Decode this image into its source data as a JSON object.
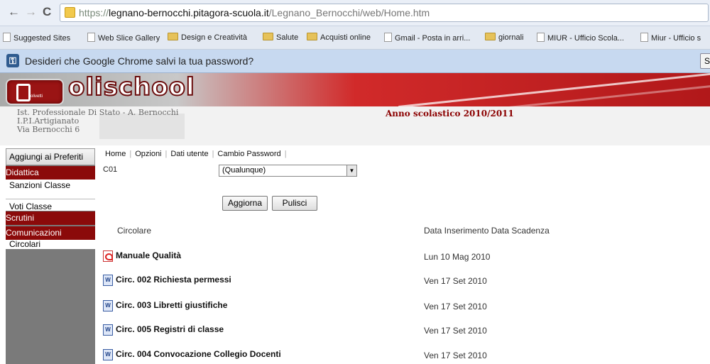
{
  "browser": {
    "url_proto": "https://",
    "url_host": "legnano-bernocchi.pitagora-scuola.it",
    "url_path": "/Legnano_Bernocchi/web/Home.htm",
    "bookmarks": [
      {
        "label": "Suggested Sites",
        "icon": "page-icon"
      },
      {
        "label": "Web Slice Gallery",
        "icon": "page-icon"
      },
      {
        "label": "Design e Creatività",
        "icon": "folder-icon"
      },
      {
        "label": "Salute",
        "icon": "folder-icon"
      },
      {
        "label": "Acquisti online",
        "icon": "folder-icon"
      },
      {
        "label": "Gmail - Posta in arri...",
        "icon": "page-icon"
      },
      {
        "label": "giornali",
        "icon": "folder-icon"
      },
      {
        "label": "MIUR - Ufficio Scola...",
        "icon": "page-icon"
      },
      {
        "label": "Miur - Ufficio s",
        "icon": "page-icon"
      }
    ],
    "infobar_message": "Desideri che Google Chrome salvi la tua password?",
    "infobar_button": "S"
  },
  "site": {
    "brand": "olischool",
    "logo_small": "olivetti",
    "school_lines": [
      "Ist. Professionale Di Stato - A. Bernocchi",
      "I.P.I.Artigianato",
      "Via Bernocchi 6"
    ],
    "school_year": "Anno scolastico 2010/2011"
  },
  "sidebar": {
    "favorites_button": "Aggiungi ai Preferiti",
    "sections": [
      {
        "label": "Didattica",
        "items": [
          "Sanzioni Classe",
          "Voti Classe"
        ]
      },
      {
        "label": "Scrutini",
        "items": []
      },
      {
        "label": "Comunicazioni",
        "items": [
          "Circolari"
        ]
      }
    ]
  },
  "topmenu": [
    "Home",
    "Opzioni",
    "Dati utente",
    "Cambio Password"
  ],
  "filter": {
    "label": "C01",
    "select_value": "(Qualunque)",
    "update_button": "Aggiorna",
    "clear_button": "Pulisci"
  },
  "table": {
    "col_circolare": "Circolare",
    "col_dates": "Data Inserimento Data Scadenza",
    "rows": [
      {
        "title": "Manuale Qualità",
        "date": "Lun 10 Mag 2010",
        "icon": "pdf-icon"
      },
      {
        "title": "Circ. 002 Richiesta permessi",
        "date": "Ven 17 Set 2010",
        "icon": "word-doc-icon"
      },
      {
        "title": "Circ. 003 Libretti giustifiche",
        "date": "Ven 17 Set 2010",
        "icon": "word-doc-icon"
      },
      {
        "title": "Circ. 005 Registri di classe",
        "date": "Ven 17 Set 2010",
        "icon": "word-doc-icon"
      },
      {
        "title": "Circ. 004 Convocazione Collegio Docenti",
        "date": "Ven 17 Set 2010",
        "icon": "word-doc-icon"
      }
    ]
  }
}
